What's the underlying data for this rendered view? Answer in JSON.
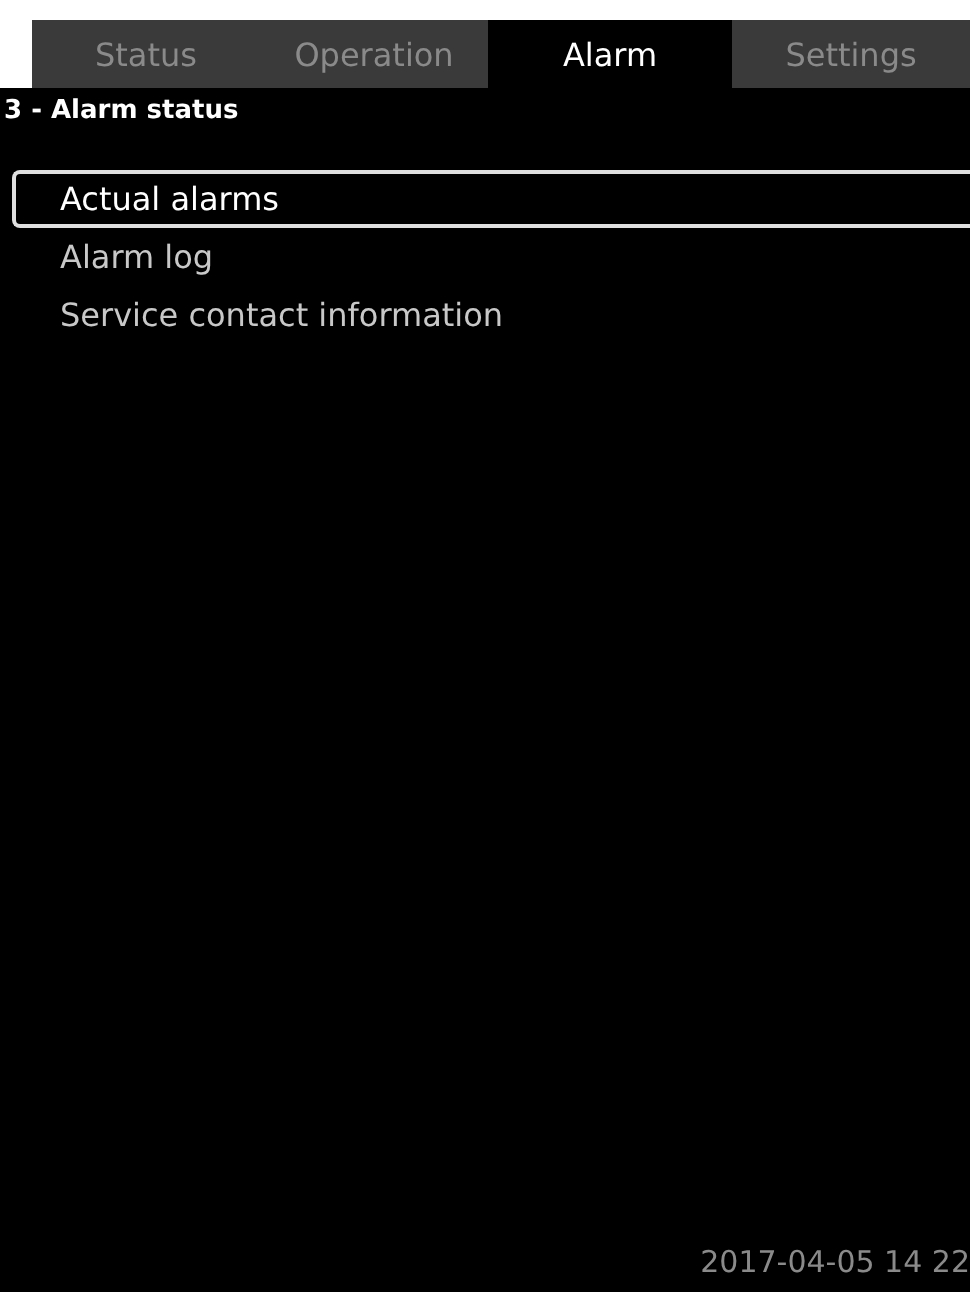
{
  "tabs": [
    {
      "label": "Status",
      "selected": false
    },
    {
      "label": "Operation",
      "selected": false
    },
    {
      "label": "Alarm",
      "selected": true
    },
    {
      "label": "Settings",
      "selected": false
    }
  ],
  "heading": "3 - Alarm status",
  "menu": [
    {
      "label": "Actual alarms",
      "selected": true
    },
    {
      "label": "Alarm log",
      "selected": false
    },
    {
      "label": "Service contact information",
      "selected": false
    }
  ],
  "status_bar": {
    "datetime": "2017-04-05 14 22"
  }
}
